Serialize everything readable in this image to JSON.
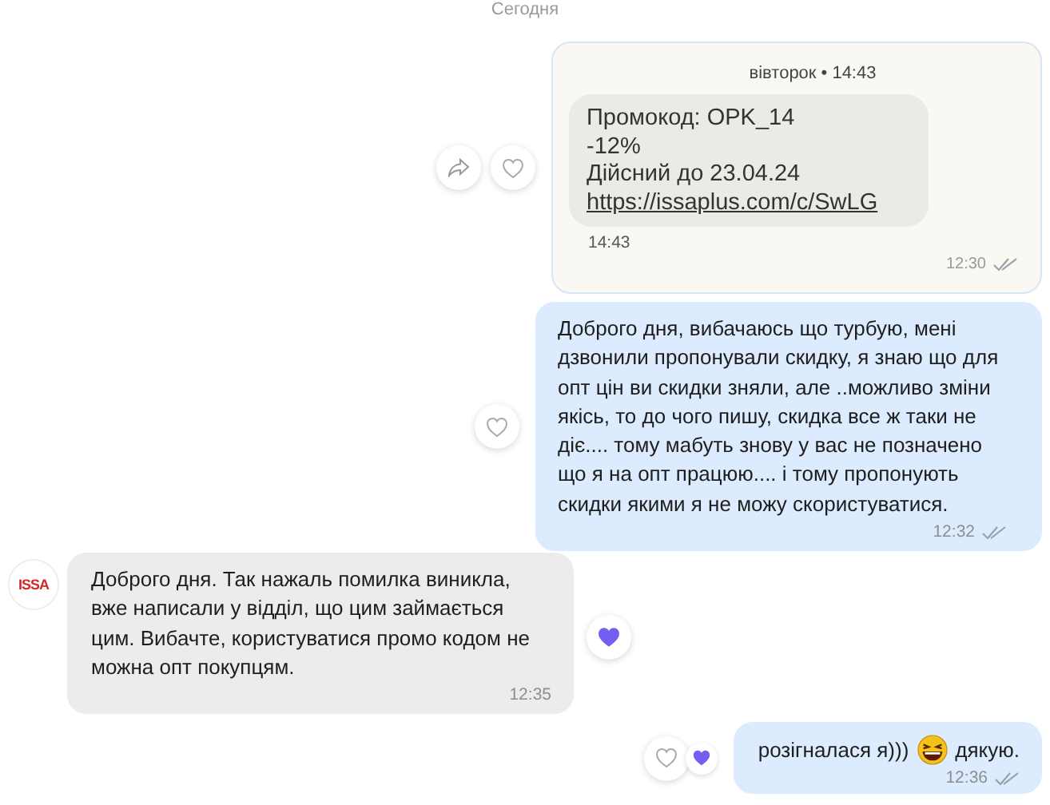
{
  "date_separator": "Сегодня",
  "messages": [
    {
      "kind": "image",
      "time": "12:30",
      "read": true,
      "share_button": true,
      "like_button": true,
      "liked": false,
      "screenshot": {
        "header": "вівторок • 14:43",
        "lines": [
          "Промокод: OPK_14",
          "-12%",
          "Дійсний до 23.04.24"
        ],
        "link": "https://issaplus.com/c/SwLG",
        "time": "14:43"
      }
    },
    {
      "kind": "sent",
      "parts": [
        {
          "kind": "text",
          "text": "Доброго дня, вибачаюсь що турбую, мені дзвонили пропонували скидку, я знаю що для опт цін ви скидки зняли, але ..можливо зміни якісь, то до чого пишу, скидка все ж таки не діє.... тому мабуть знову у вас не позначено що я на опт працюю.... і тому пропонують скидки якими я не можу скористуватися."
        }
      ],
      "time": "12:32",
      "read": true,
      "like_button": true,
      "liked": false
    },
    {
      "kind": "received",
      "avatar": {
        "logo": "ISSA"
      },
      "parts": [
        {
          "kind": "text",
          "text": "Доброго дня. Так нажаль помилка виникла, вже написали у відділ, що цим займається цим. Вибачте, користуватися промо кодом не можна опт покупцям."
        }
      ],
      "time": "12:35",
      "liked": true
    },
    {
      "kind": "sent",
      "parts": [
        {
          "kind": "text",
          "text": "розігналася я)))"
        },
        {
          "kind": "emoji"
        },
        {
          "kind": "text",
          "text": "дякую."
        }
      ],
      "time": "12:36",
      "read": true,
      "like_button": true,
      "liked": true
    }
  ]
}
